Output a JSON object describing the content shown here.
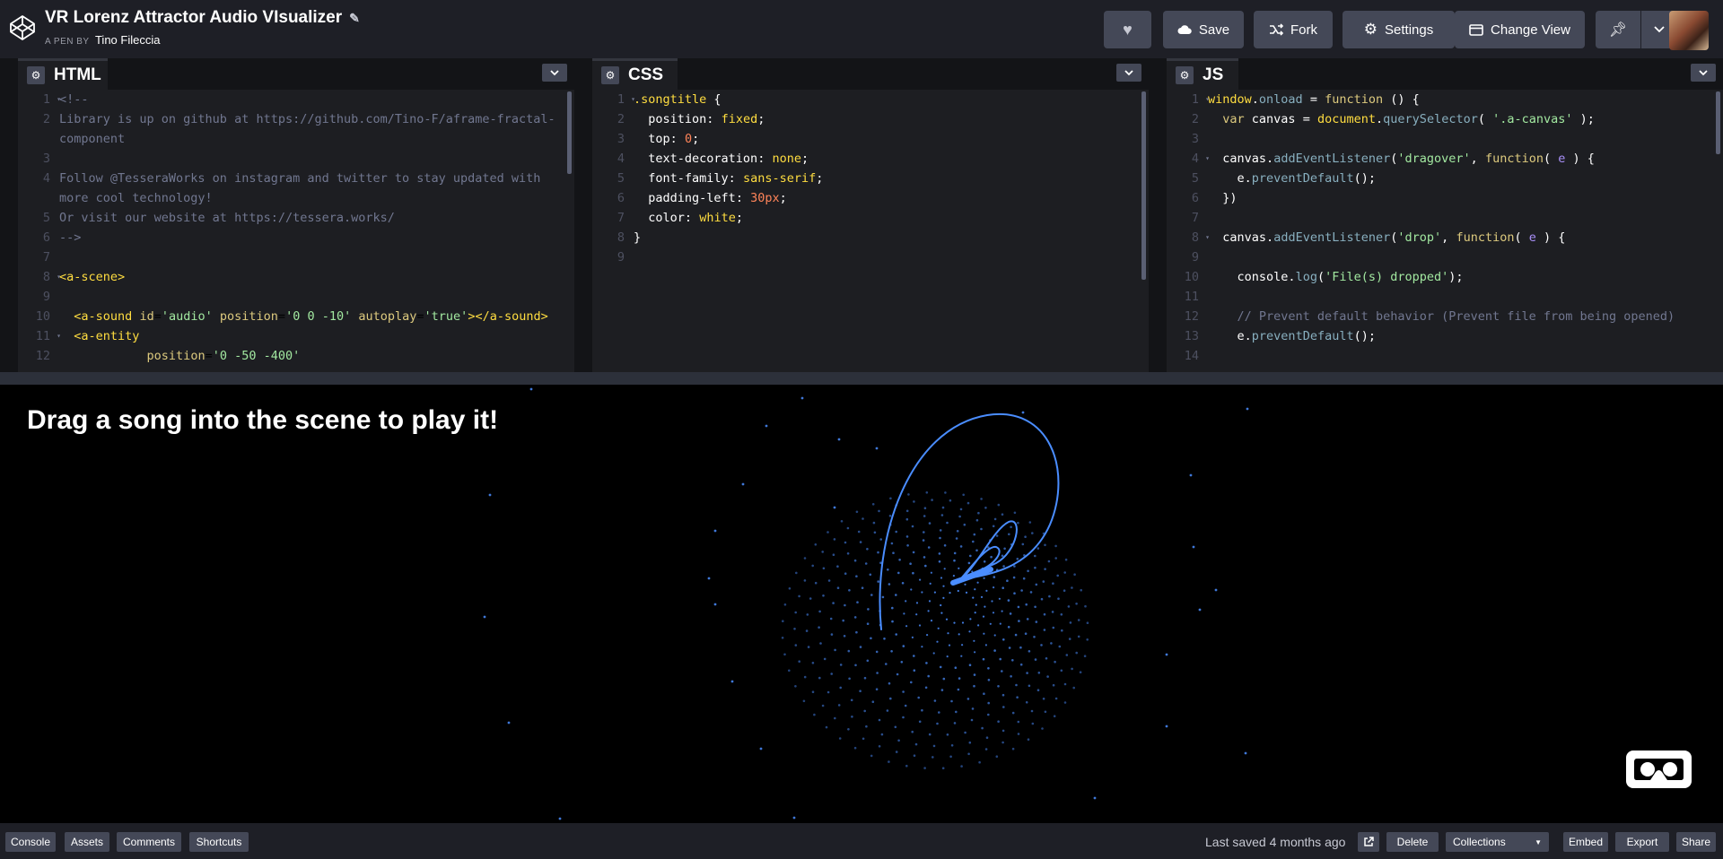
{
  "header": {
    "title": "VR Lorenz Attractor Audio VIsualizer",
    "author_prefix": "A PEN BY",
    "author": "Tino Fileccia",
    "buttons": {
      "save": "Save",
      "fork": "Fork",
      "settings": "Settings",
      "change_view": "Change View"
    }
  },
  "editors": {
    "html": {
      "name": "HTML",
      "lines": [
        {
          "n": "1",
          "fold": true,
          "html": "<span class='cm'>&lt;!--</span>"
        },
        {
          "n": "2",
          "html": "<span class='cm'>Library is up on github at https://github.com/Tino-F/aframe-fractal-</span>"
        },
        {
          "n": "",
          "html": "<span class='cm'>component</span>"
        },
        {
          "n": "3",
          "html": ""
        },
        {
          "n": "4",
          "html": "<span class='cm'>Follow @TesseraWorks on instagram and twitter to stay updated with</span>"
        },
        {
          "n": "",
          "html": "<span class='cm'>more cool technology!</span>"
        },
        {
          "n": "5",
          "html": "<span class='cm'>Or visit our website at https://tessera.works/</span>"
        },
        {
          "n": "6",
          "html": "<span class='cm'>--&gt;</span>"
        },
        {
          "n": "7",
          "html": ""
        },
        {
          "n": "8",
          "fold": true,
          "html": "<span class='tg'>&lt;a-scene&gt;</span>"
        },
        {
          "n": "9",
          "html": ""
        },
        {
          "n": "10",
          "html": "  <span class='tg'>&lt;a-sound</span> <span class='at'>id</span>=<span class='st'>'audio'</span> <span class='at'>position</span>=<span class='st'>'0 0 -10'</span> <span class='at'>autoplay</span>=<span class='st'>'true'</span><span class='tg'>&gt;&lt;/a-sound&gt;</span>"
        },
        {
          "n": "11",
          "fold": true,
          "html": "  <span class='tg'>&lt;a-entity</span>"
        },
        {
          "n": "12",
          "html": "            <span class='at'>position</span>=<span class='st'>'0 -50 -400'</span>"
        }
      ]
    },
    "css": {
      "name": "CSS",
      "lines": [
        {
          "n": "1",
          "fold": true,
          "html": "<span class='sel'>.songtitle</span> <span class='txt'>{</span>"
        },
        {
          "n": "2",
          "html": "  <span class='prop'>position</span><span class='txt'>:</span> <span class='tg'>fixed</span><span class='txt'>;</span>"
        },
        {
          "n": "3",
          "html": "  <span class='prop'>top</span><span class='txt'>:</span> <span class='num'>0</span><span class='txt'>;</span>"
        },
        {
          "n": "4",
          "html": "  <span class='prop'>text-decoration</span><span class='txt'>:</span> <span class='tg'>none</span><span class='txt'>;</span>"
        },
        {
          "n": "5",
          "html": "  <span class='prop'>font-family</span><span class='txt'>:</span> <span class='tg'>sans-serif</span><span class='txt'>;</span>"
        },
        {
          "n": "6",
          "html": "  <span class='prop'>padding-left</span><span class='txt'>:</span> <span class='num'>30px</span><span class='txt'>;</span>"
        },
        {
          "n": "7",
          "html": "  <span class='prop'>color</span><span class='txt'>:</span> <span class='tg'>white</span><span class='txt'>;</span>"
        },
        {
          "n": "8",
          "html": "<span class='txt'>}</span>"
        },
        {
          "n": "9",
          "html": ""
        }
      ]
    },
    "js": {
      "name": "JS",
      "lines": [
        {
          "n": "1",
          "fold": true,
          "html": "<span class='tg'>window</span><span class='txt'>.</span><span class='va'>onload</span> <span class='txt'>=</span> <span class='kw'>function</span> <span class='txt'>() {</span>"
        },
        {
          "n": "2",
          "html": "  <span class='kw'>var</span> <span class='txt'>canvas</span> <span class='txt'>=</span> <span class='tg'>document</span><span class='txt'>.</span><span class='va'>querySelector</span><span class='txt'>(</span> <span class='st'>'.a-canvas'</span> <span class='txt'>);</span>"
        },
        {
          "n": "3",
          "html": ""
        },
        {
          "n": "4",
          "fold": true,
          "html": "  <span class='txt'>canvas</span><span class='txt'>.</span><span class='va'>addEventListener</span><span class='txt'>(</span><span class='st'>'dragover'</span><span class='txt'>,</span> <span class='kw'>function</span><span class='txt'>(</span> <span class='fn'>e</span> <span class='txt'>) {</span>"
        },
        {
          "n": "5",
          "html": "    <span class='txt'>e</span><span class='txt'>.</span><span class='va'>preventDefault</span><span class='txt'>();</span>"
        },
        {
          "n": "6",
          "html": "  <span class='txt'>})</span>"
        },
        {
          "n": "7",
          "html": ""
        },
        {
          "n": "8",
          "fold": true,
          "html": "  <span class='txt'>canvas</span><span class='txt'>.</span><span class='va'>addEventListener</span><span class='txt'>(</span><span class='st'>'drop'</span><span class='txt'>,</span> <span class='kw'>function</span><span class='txt'>(</span> <span class='fn'>e</span> <span class='txt'>) {</span>"
        },
        {
          "n": "9",
          "html": ""
        },
        {
          "n": "10",
          "html": "    <span class='txt'>console</span><span class='txt'>.</span><span class='va'>log</span><span class='txt'>(</span><span class='st'>'File(s) dropped'</span><span class='txt'>);</span>"
        },
        {
          "n": "11",
          "html": ""
        },
        {
          "n": "12",
          "html": "    <span class='cm'>// Prevent default behavior (Prevent file from being opened)</span>"
        },
        {
          "n": "13",
          "html": "    <span class='txt'>e</span><span class='txt'>.</span><span class='va'>preventDefault</span><span class='txt'>();</span>"
        },
        {
          "n": "14",
          "html": ""
        }
      ]
    }
  },
  "preview": {
    "songtitle": "Drag a song into the scene to play it!"
  },
  "footer": {
    "console": "Console",
    "assets": "Assets",
    "comments": "Comments",
    "shortcuts": "Shortcuts",
    "last_saved": "Last saved 4 months ago",
    "delete": "Delete",
    "collections": "Collections",
    "embed": "Embed",
    "export": "Export",
    "share": "Share"
  },
  "colors": {
    "visualizer": "#4a8dff",
    "header_bg": "#1e1f26",
    "button_bg": "#444857"
  }
}
